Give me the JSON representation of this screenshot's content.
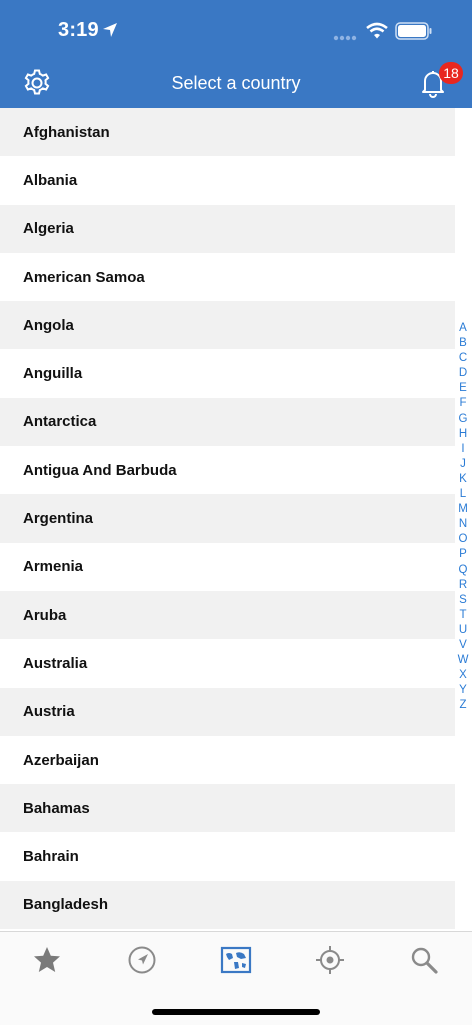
{
  "status_bar": {
    "time": "3:19"
  },
  "header": {
    "title": "Select a country",
    "notification_count": "18"
  },
  "countries": [
    "Afghanistan",
    "Albania",
    "Algeria",
    "American Samoa",
    "Angola",
    "Anguilla",
    "Antarctica",
    "Antigua And Barbuda",
    "Argentina",
    "Armenia",
    "Aruba",
    "Australia",
    "Austria",
    "Azerbaijan",
    "Bahamas",
    "Bahrain",
    "Bangladesh"
  ],
  "index_letters": [
    "A",
    "B",
    "C",
    "D",
    "E",
    "F",
    "G",
    "H",
    "I",
    "J",
    "K",
    "L",
    "M",
    "N",
    "O",
    "P",
    "Q",
    "R",
    "S",
    "T",
    "U",
    "V",
    "W",
    "X",
    "Y",
    "Z"
  ],
  "tabs": [
    "star-icon",
    "compass-icon",
    "map-icon",
    "crosshair-icon",
    "search-icon"
  ],
  "colors": {
    "header_bg": "#3a78c4",
    "accent": "#2a7bd5",
    "badge": "#e8271f"
  }
}
